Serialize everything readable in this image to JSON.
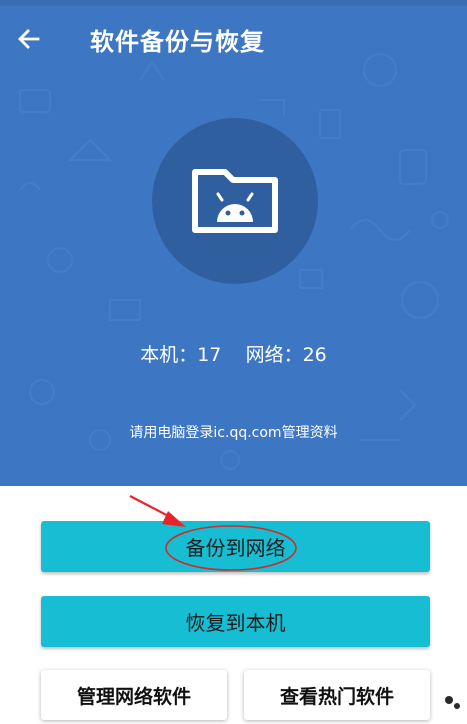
{
  "header": {
    "title": "软件备份与恢复",
    "back_icon": "arrow-left-icon"
  },
  "hero": {
    "icon": "android-folder-icon",
    "local_label": "本机：",
    "local_count": "17",
    "network_label": "网络：",
    "network_count": "26",
    "note": "请用电脑登录ic.qq.com管理资料"
  },
  "actions": {
    "backup_label": "备份到网络",
    "restore_label": "恢复到本机",
    "manage_label": "管理网络软件",
    "hot_label": "查看热门软件"
  },
  "colors": {
    "header_bg": "#3d77c4",
    "circle": "#2f5f9f",
    "primary_button": "#17bdd3",
    "annotation": "#e8242a"
  }
}
